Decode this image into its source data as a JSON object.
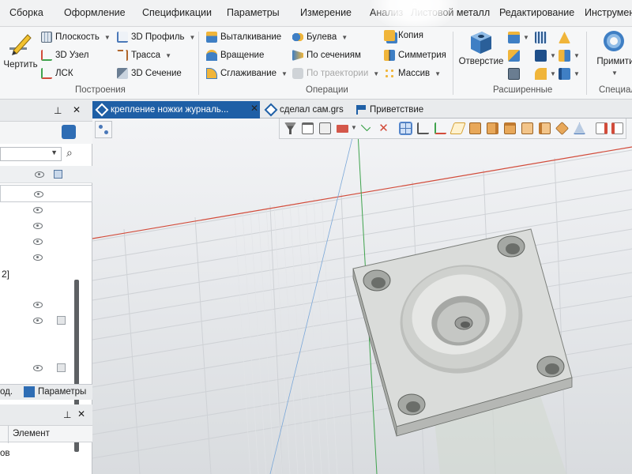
{
  "menu": [
    "Сборка",
    "Оформление",
    "Спецификации",
    "Параметры",
    "Измерение",
    "Анализ",
    "Листовой металл",
    "Редактирование",
    "Инструменты"
  ],
  "ribbon": {
    "draw_label": "Чертить",
    "construct": {
      "label": "Построения",
      "items": [
        "Плоскость",
        "3D Профиль",
        "3D Узел",
        "Трасса",
        "ЛСК",
        "3D Сечение"
      ]
    },
    "operations": {
      "label": "Операции",
      "items": [
        "Выталкивание",
        "Булева",
        "Копия",
        "Вращение",
        "По сечениям",
        "Симметрия",
        "Сглаживание",
        "По траектории",
        "Массив"
      ]
    },
    "advanced": {
      "label": "Расширенные",
      "hole_label": "Отверстие"
    },
    "special": {
      "label": "Специал",
      "primitive_label": "Примитив"
    }
  },
  "left_panel": {
    "row_fragments": [
      "2]",
      "од.",
      "Параметры",
      "Элемент",
      "ов"
    ]
  },
  "tabs": [
    {
      "label": "крепление ножки журналь...",
      "active": true
    },
    {
      "label": "сделал сам.grs",
      "active": false
    },
    {
      "label": "Приветствие",
      "active": false
    }
  ],
  "colors": {
    "accent": "#1e5fa6",
    "plate_top": "#dadcda",
    "plate_side": "#b5b7b4",
    "x_axis": "#d24b3a",
    "y_axis": "#3fa34d"
  }
}
